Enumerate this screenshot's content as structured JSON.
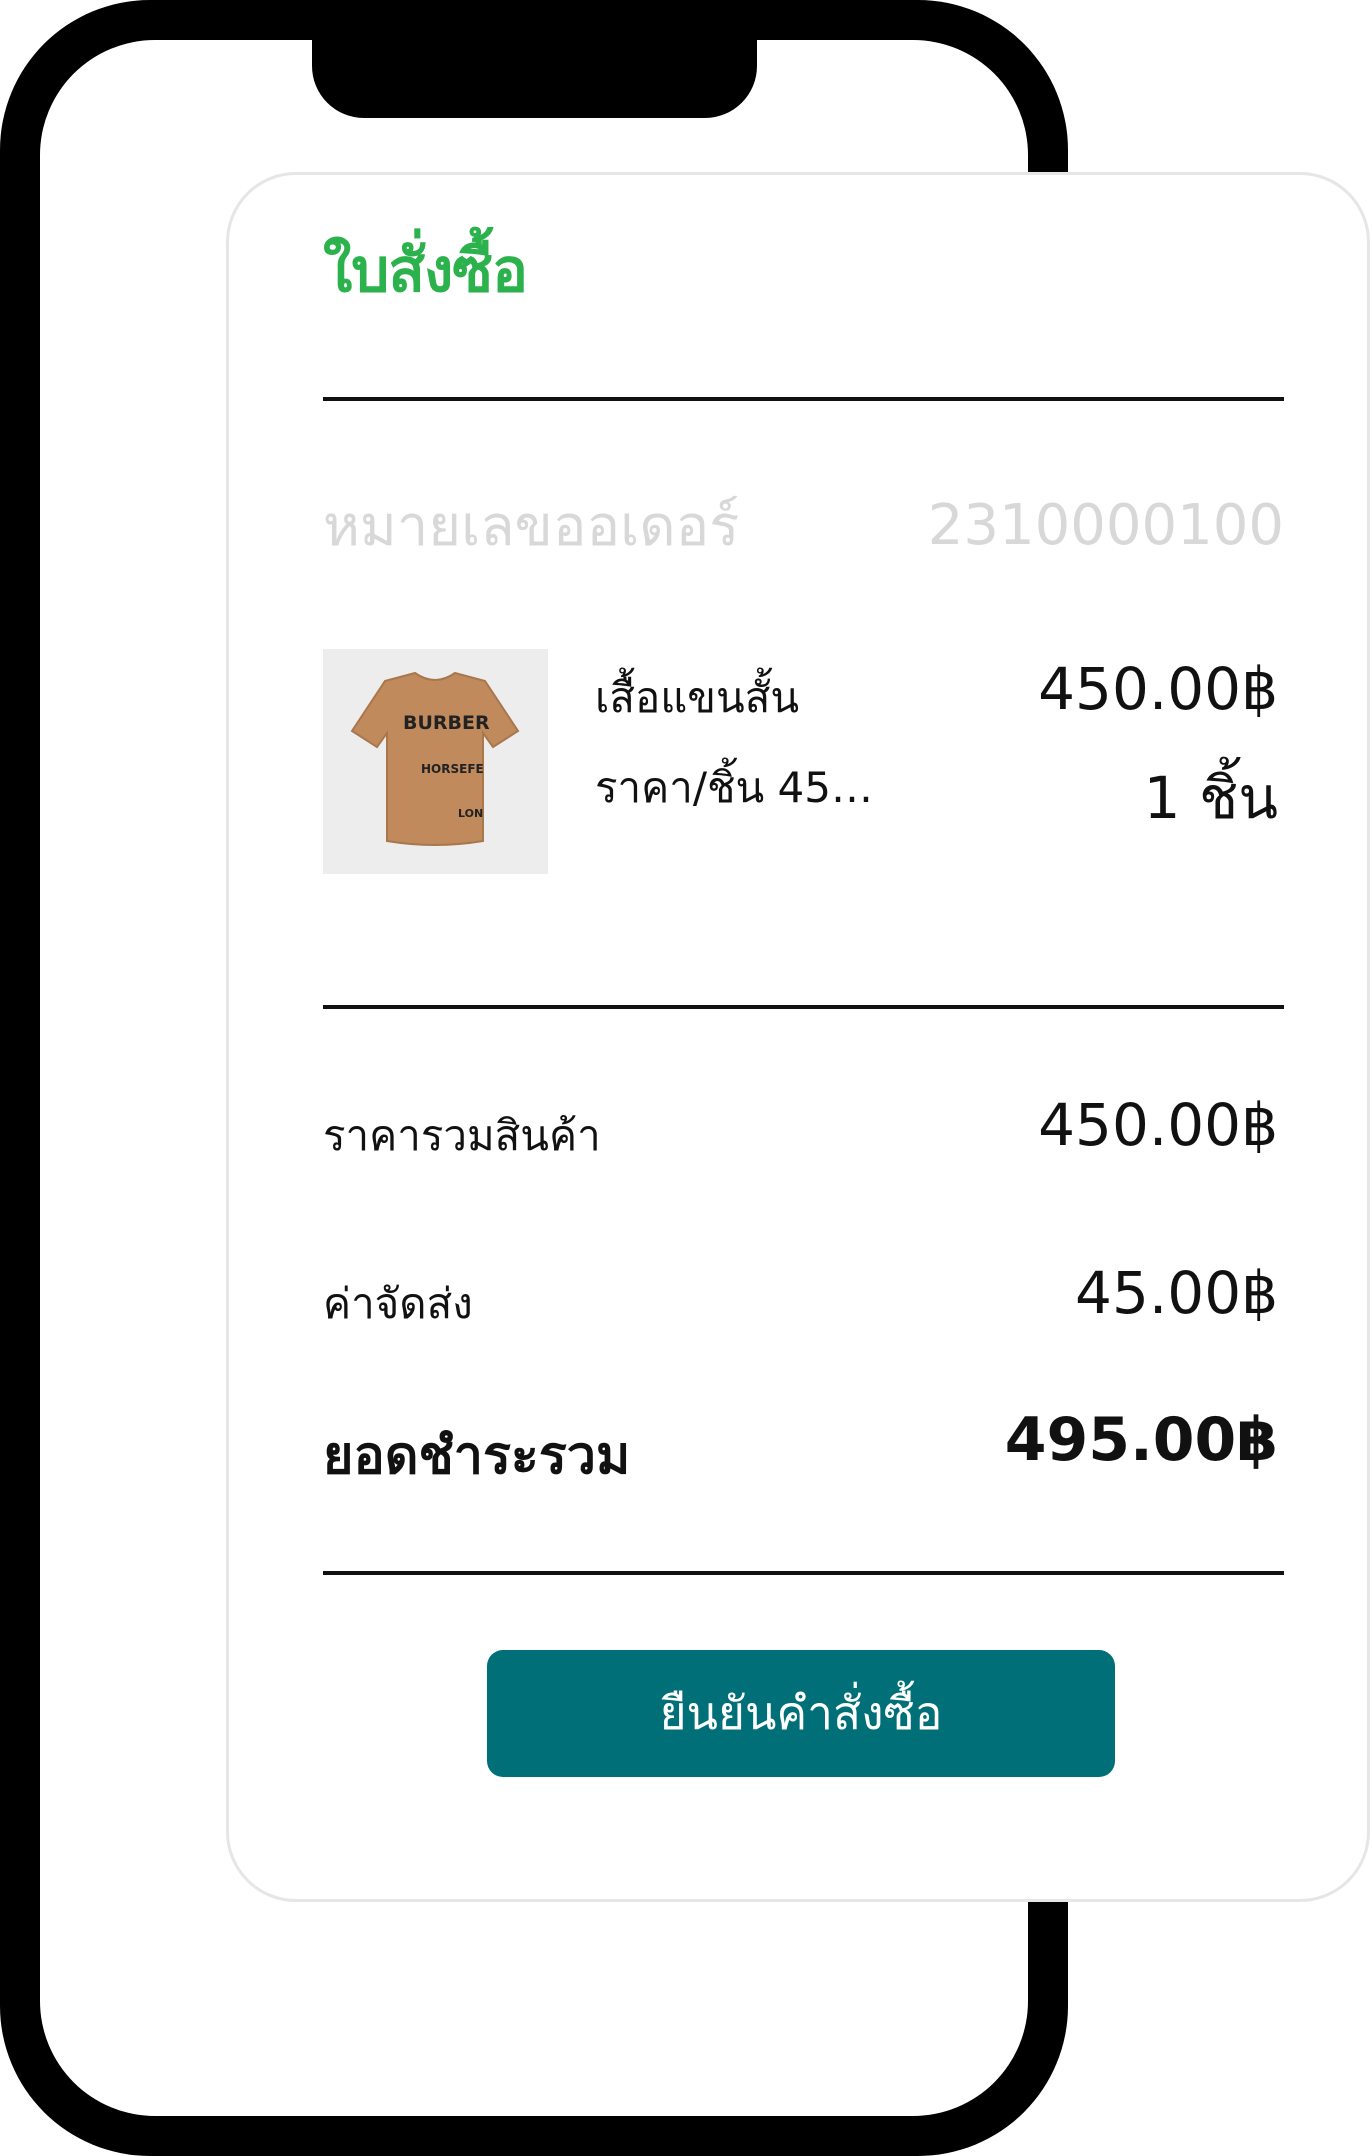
{
  "receipt": {
    "title": "ใบสั่งซื้อ",
    "order_number_label": "หมายเลขออเดอร์",
    "order_number": "2310000100",
    "item": {
      "name": "เสื้อแขนสั้น",
      "unit_price": "ราคา/ชิ้น 450...",
      "line_total": "450.00฿",
      "quantity": "1 ชิ้น",
      "image_text": {
        "line1": "BURBER",
        "line2": "HORSEFE",
        "line3": "LON"
      }
    },
    "subtotal_label": "ราคารวมสินค้า",
    "subtotal_value": "450.00฿",
    "shipping_label": "ค่าจัดส่ง",
    "shipping_value": "45.00฿",
    "total_label": "ยอดชำระรวม",
    "total_value": "495.00฿",
    "confirm_label": "ยืนยันคำสั่งซื้อ"
  },
  "colors": {
    "title_green": "#2bb24c",
    "button_teal": "#006f78",
    "muted_text": "#d8d8d8",
    "shirt_tan": "#c08a5c"
  },
  "icons": {
    "product_image": "tshirt-photo"
  }
}
